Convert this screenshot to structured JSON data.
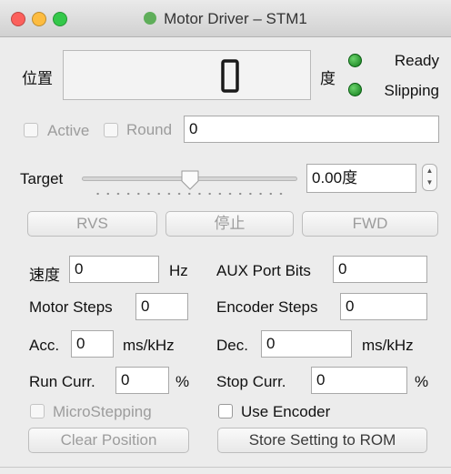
{
  "window": {
    "title": "Motor Driver – STM1"
  },
  "position": {
    "label": "位置",
    "display_value": "0",
    "unit": "度"
  },
  "status": {
    "ready": "Ready",
    "slipping": "Slipping",
    "led_color": "#2bb52b"
  },
  "options": {
    "active_label": "Active",
    "round_label": "Round",
    "round_value": "0"
  },
  "target": {
    "label": "Target",
    "value": "0.00度",
    "slider_fraction": 0.5
  },
  "buttons": {
    "rvs": "RVS",
    "stop": "停止",
    "fwd": "FWD",
    "clear_position": "Clear Position",
    "store": "Store Setting to ROM"
  },
  "params": {
    "speed": {
      "label": "速度",
      "value": "0",
      "unit": "Hz"
    },
    "aux": {
      "label": "AUX Port Bits",
      "value": "0"
    },
    "motor_steps": {
      "label": "Motor Steps",
      "value": "0"
    },
    "encoder_steps": {
      "label": "Encoder Steps",
      "value": "0"
    },
    "acc": {
      "label": "Acc.",
      "value": "0",
      "unit": "ms/kHz"
    },
    "dec": {
      "label": "Dec.",
      "value": "0",
      "unit": "ms/kHz"
    },
    "run_curr": {
      "label": "Run Curr.",
      "value": "0",
      "unit": "%"
    },
    "stop_curr": {
      "label": "Stop Curr.",
      "value": "0",
      "unit": "%"
    }
  },
  "checks": {
    "microstepping": "MicroStepping",
    "use_encoder": "Use Encoder"
  },
  "icons": {
    "close": "close-light-icon",
    "minimize": "minimize-light-icon",
    "zoom": "zoom-light-icon",
    "app": "app-icon"
  },
  "colors": {
    "close": "#fc605c",
    "minimize": "#fdbc40",
    "zoom": "#34c84a"
  }
}
